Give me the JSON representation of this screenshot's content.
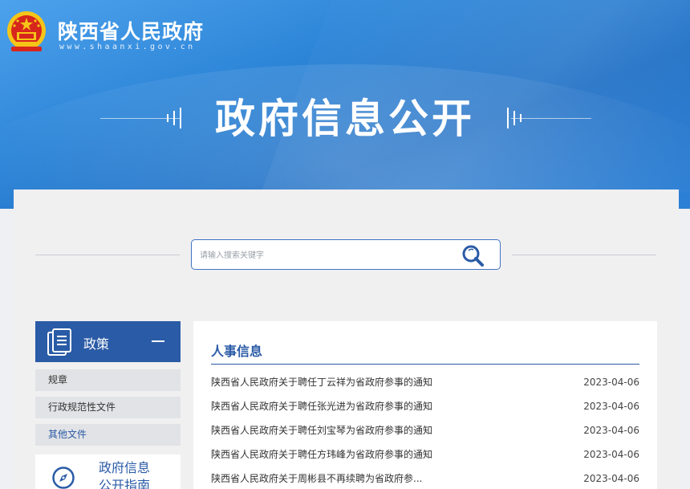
{
  "header": {
    "site_name": "陕西省人民政府",
    "site_domain": "www.shaanxi.gov.cn",
    "page_title": "政府信息公开"
  },
  "search": {
    "placeholder": "请输入搜索关键字",
    "icon": "search-icon"
  },
  "sidebar": {
    "head_label": "政策",
    "head_icon": "document-icon",
    "items": [
      {
        "label": "规章"
      },
      {
        "label": "行政规范性文件"
      },
      {
        "label": "其他文件"
      }
    ],
    "guide": {
      "line1": "政府信息",
      "line2": "公开指南",
      "icon": "compass-icon"
    }
  },
  "main": {
    "section_title": "人事信息",
    "news": [
      {
        "title": "陕西省人民政府关于聘任丁云祥为省政府参事的通知",
        "date": "2023-04-06"
      },
      {
        "title": "陕西省人民政府关于聘任张光进为省政府参事的通知",
        "date": "2023-04-06"
      },
      {
        "title": "陕西省人民政府关于聘任刘宝琴为省政府参事的通知",
        "date": "2023-04-06"
      },
      {
        "title": "陕西省人民政府关于聘任方玮峰为省政府参事的通知",
        "date": "2023-04-06"
      },
      {
        "title": "陕西省人民政府关于周彬县不再续聘为省政府参...",
        "date": "2023-04-06"
      }
    ]
  },
  "colors": {
    "primary": "#2a5ba6",
    "banner": "#2e86d8",
    "emblem_red": "#d7261c",
    "emblem_gold": "#f5c518"
  }
}
